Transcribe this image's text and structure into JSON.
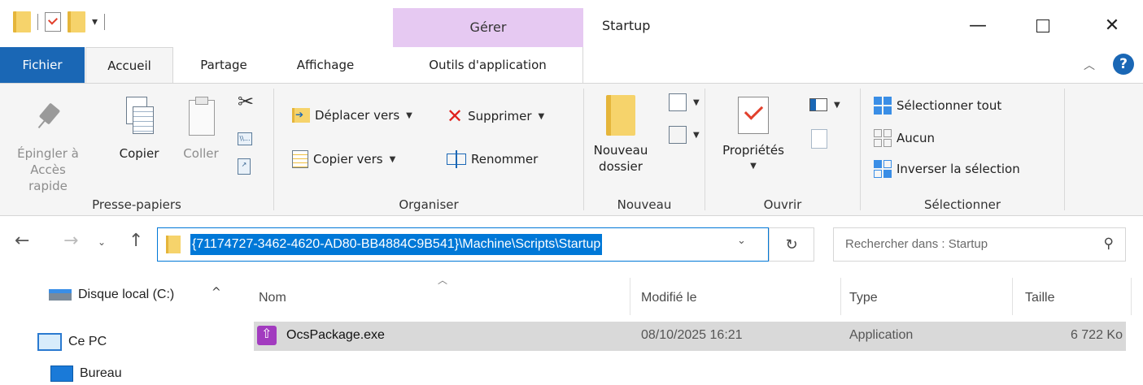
{
  "titlebar": {
    "manage_label": "Gérer",
    "window_title": "Startup",
    "minimize": "—",
    "close": "✕"
  },
  "tabs": {
    "file": "Fichier",
    "home": "Accueil",
    "share": "Partage",
    "view": "Affichage",
    "app_tools": "Outils d'application"
  },
  "ribbon": {
    "clipboard": {
      "pin_line1": "Épingler à",
      "pin_line2": "Accès rapide",
      "copy": "Copier",
      "paste": "Coller",
      "label": "Presse-papiers"
    },
    "organize": {
      "move_to": "Déplacer vers",
      "copy_to": "Copier vers",
      "delete": "Supprimer",
      "rename": "Renommer",
      "label": "Organiser"
    },
    "new": {
      "new_folder_line1": "Nouveau",
      "new_folder_line2": "dossier",
      "label": "Nouveau"
    },
    "open": {
      "properties": "Propriétés",
      "label": "Ouvrir"
    },
    "select": {
      "select_all": "Sélectionner tout",
      "select_none": "Aucun",
      "invert": "Inverser la sélection",
      "label": "Sélectionner"
    }
  },
  "address": {
    "path": "{71174727-3462-4620-AD80-BB4884C9B541}\\Machine\\Scripts\\Startup",
    "search_placeholder": "Rechercher dans : Startup"
  },
  "navpane": {
    "items": [
      {
        "label": "Disque local (C:)",
        "icon": "drive-icon"
      },
      {
        "label": "Ce PC",
        "icon": "pc-icon"
      },
      {
        "label": "Bureau",
        "icon": "desktop-icon"
      }
    ]
  },
  "filelist": {
    "columns": [
      "Nom",
      "Modifié le",
      "Type",
      "Taille"
    ],
    "rows": [
      {
        "name": "OcsPackage.exe",
        "modified": "08/10/2025 16:21",
        "type": "Application",
        "size": "6 722 Ko",
        "icon": "application-icon"
      }
    ]
  }
}
